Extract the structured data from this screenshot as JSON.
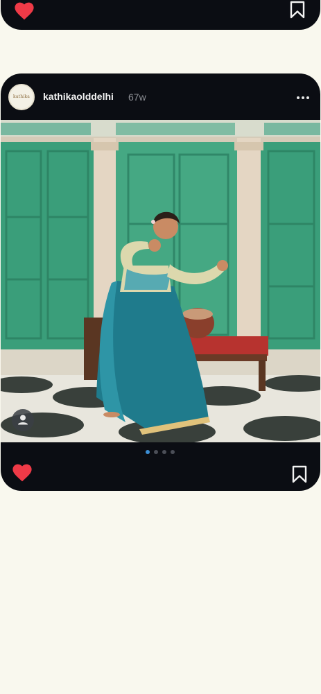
{
  "post_top": {
    "liked": true,
    "saved": false
  },
  "post": {
    "username": "kathikaolddelhi",
    "age": "67w",
    "avatar_logo_text": "kathika",
    "more_icon": "more-horizontal-icon",
    "user_tag_icon": "person-icon",
    "carousel": {
      "count": 4,
      "active_index": 1
    },
    "liked": true,
    "saved": false
  },
  "colors": {
    "background": "#f9f8ee",
    "card": "#0b0d13",
    "like_red": "#ef3a47",
    "active_dot": "#3c8fd6"
  }
}
